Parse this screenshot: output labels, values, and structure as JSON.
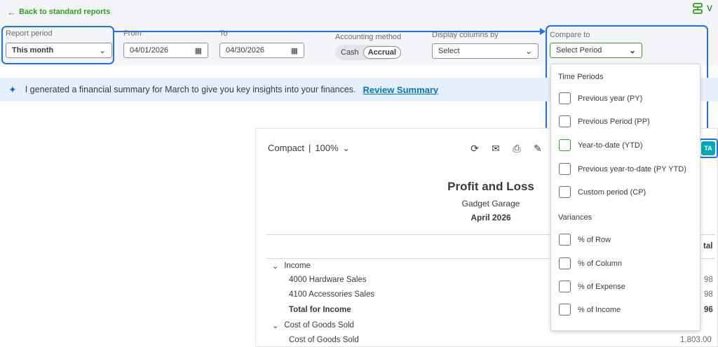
{
  "nav": {
    "back_label": "Back to standard reports",
    "top_right_label": "V"
  },
  "filters": {
    "report_period": {
      "label": "Report period",
      "value": "This month"
    },
    "from": {
      "label": "From",
      "value": "04/01/2026"
    },
    "to": {
      "label": "To",
      "value": "04/30/2026"
    },
    "accounting_method": {
      "label": "Accounting method",
      "options": [
        "Cash",
        "Accrual"
      ],
      "selected": "Accrual"
    },
    "display_columns": {
      "label": "Display columns by",
      "value": "Select"
    },
    "compare_to": {
      "label": "Compare to",
      "value": "Select Period"
    }
  },
  "banner": {
    "text": "I generated a financial summary for March to give you key insights into your finances.",
    "link": "Review Summary"
  },
  "report": {
    "view_label": "Compact",
    "zoom": "100%",
    "title": "Profit and Loss",
    "company": "Gadget Garage",
    "period": "April 2026",
    "column_header_partial": "tal",
    "tag_text": "TA",
    "rows": [
      {
        "label": "Income",
        "type": "section",
        "value": ""
      },
      {
        "label": "4000 Hardware Sales",
        "type": "item",
        "value": "98"
      },
      {
        "label": "4100 Accessories Sales",
        "type": "item",
        "value": "98"
      },
      {
        "label": "Total for Income",
        "type": "total",
        "value": "96"
      },
      {
        "label": "Cost of Goods Sold",
        "type": "section",
        "value": ""
      },
      {
        "label": "Cost of Goods Sold",
        "type": "item",
        "value": "1,803.00"
      }
    ]
  },
  "compare_dropdown": {
    "time_periods_heading": "Time Periods",
    "time_periods": [
      "Previous year (PY)",
      "Previous Period (PP)",
      "Year-to-date (YTD)",
      "Previous year-to-date (PY YTD)",
      "Custom period (CP)"
    ],
    "variances_heading": "Variances",
    "variances": [
      "% of Row",
      "% of Column",
      "% of Expense",
      "% of Income"
    ]
  },
  "colors": {
    "accent_green": "#2ca01c",
    "highlight_blue": "#1a73e8",
    "link_blue": "#0077c5"
  }
}
